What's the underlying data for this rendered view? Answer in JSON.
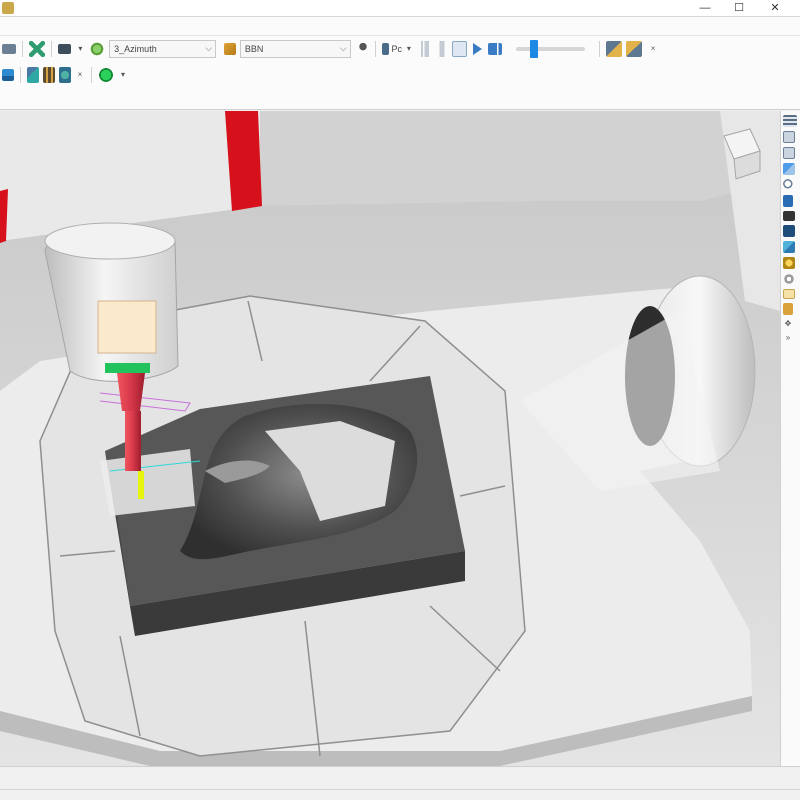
{
  "window": {
    "title": "",
    "minimize_glyph": "—",
    "maximize_glyph": "☐",
    "close_glyph": "✕"
  },
  "toolbar_row1": {
    "axis_combo_value": "3_Azimuth",
    "tool_combo_value": "BBN",
    "speed_label": "Pc",
    "close_glyph": "×"
  },
  "toolbar_row2": {
    "close_glyph": "×"
  },
  "icons": {
    "row1": [
      "menu-icon",
      "move-icon",
      "group-icon",
      "axis-icon",
      "tool-icon",
      "pin-icon",
      "speed-icon",
      "first-step-icon",
      "step-back-icon",
      "pause-icon",
      "play-icon",
      "last-step-icon",
      "slider-icon",
      "view-a-icon",
      "view-b-icon"
    ],
    "row2": [
      "window-icon",
      "measure-icon",
      "library-icon",
      "material-icon",
      "run-icon"
    ],
    "rightbar": [
      "layers-icon",
      "cube-front-icon",
      "cube-top-icon",
      "cube-iso-icon",
      "zoom-icon",
      "bookmark-icon",
      "camera-icon",
      "toggle-icon",
      "box-icon",
      "sphere-icon",
      "gear-icon",
      "comment-icon",
      "lock-icon",
      "pan-icon",
      "expand-icon"
    ]
  },
  "colors": {
    "accent": "#1e88e5",
    "machine_red": "#d6111b",
    "spindle_red": "#d7384a",
    "tool_green": "#22c35d",
    "tip_yellow": "#e5f50d",
    "workpiece_dark": "#5d5d5d"
  }
}
